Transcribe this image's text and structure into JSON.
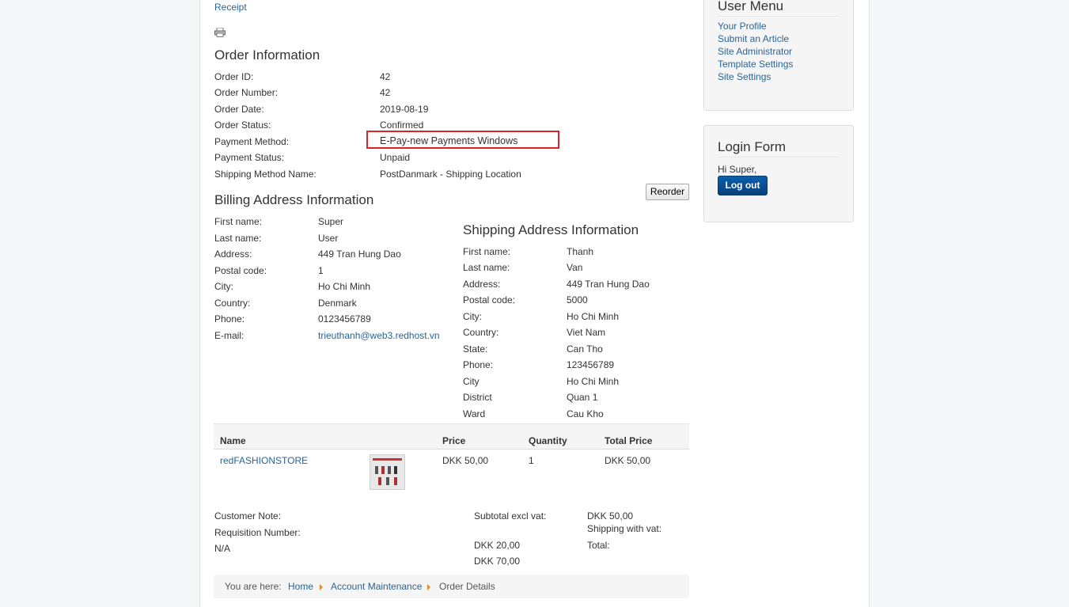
{
  "receipt_link": "Receipt",
  "order_info": {
    "title": "Order Information",
    "rows": [
      {
        "label": "Order ID:",
        "value": "42"
      },
      {
        "label": "Order Number:",
        "value": "42"
      },
      {
        "label": "Order Date:",
        "value": "2019-08-19"
      },
      {
        "label": "Order Status:",
        "value": "Confirmed"
      },
      {
        "label": "Payment Method:",
        "value": "E-Pay-new Payments Windows"
      },
      {
        "label": "Payment Status:",
        "value": "Unpaid"
      },
      {
        "label": "Shipping Method Name:",
        "value": "PostDanmark - Shipping Location"
      }
    ],
    "reorder_label": "Reorder"
  },
  "billing": {
    "title": "Billing Address Information",
    "rows": [
      {
        "label": "First name:",
        "value": "Super"
      },
      {
        "label": "Last name:",
        "value": "User"
      },
      {
        "label": "Address:",
        "value": "449 Tran Hung Dao"
      },
      {
        "label": "Postal code:",
        "value": "1"
      },
      {
        "label": "City:",
        "value": "Ho Chi Minh"
      },
      {
        "label": "Country:",
        "value": "Denmark"
      },
      {
        "label": "Phone:",
        "value": "0123456789"
      },
      {
        "label": "E-mail:",
        "value": "trieuthanh@web3.redhost.vn"
      }
    ]
  },
  "shipping": {
    "title": "Shipping Address Information",
    "rows": [
      {
        "label": "First name:",
        "value": "Thanh"
      },
      {
        "label": "Last name:",
        "value": "Van"
      },
      {
        "label": "Address:",
        "value": "449 Tran Hung Dao"
      },
      {
        "label": "Postal code:",
        "value": "5000"
      },
      {
        "label": "City:",
        "value": "Ho Chi Minh"
      },
      {
        "label": "Country:",
        "value": "Viet Nam"
      },
      {
        "label": "State:",
        "value": "Can Tho"
      },
      {
        "label": "Phone:",
        "value": "123456789"
      },
      {
        "label": "City",
        "value": "Ho Chi Minh"
      },
      {
        "label": "District",
        "value": "Quan 1"
      },
      {
        "label": "Ward",
        "value": "Cau Kho"
      }
    ]
  },
  "items_table": {
    "headers": {
      "name": "Name",
      "price": "Price",
      "quantity": "Quantity",
      "total": "Total Price"
    },
    "rows": [
      {
        "name": "redFASHIONSTORE",
        "price": "DKK 50,00",
        "quantity": "1",
        "total": "DKK 50,00"
      }
    ]
  },
  "summary": {
    "customer_note_label": "Customer Note:",
    "requisition_label": "Requisition Number:",
    "requisition_value": "N/A",
    "subtotal_label": "Subtotal excl vat:",
    "subtotal_value": "DKK 50,00",
    "shipping_label": "Shipping with vat:",
    "shipping_value": "DKK 20,00",
    "total_label": "Total:",
    "total_value": "DKK 70,00"
  },
  "breadcrumb": {
    "prefix": "You are here:",
    "items": [
      "Home",
      "Account Maintenance",
      "Order Details"
    ]
  },
  "user_menu": {
    "title": "User Menu",
    "items": [
      "Your Profile",
      "Submit an Article",
      "Site Administrator",
      "Template Settings",
      "Site Settings"
    ]
  },
  "login_form": {
    "title": "Login Form",
    "greeting": "Hi Super,",
    "logout_label": "Log out"
  },
  "colors": {
    "link": "#2a6496",
    "highlight_border": "#d9232d",
    "logout_button": "#0b5fad",
    "breadcrumb_arrow": "#e08e2b"
  }
}
